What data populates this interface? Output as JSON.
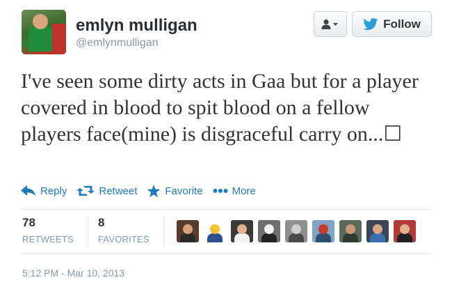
{
  "profile": {
    "display_name": "emlyn mulligan",
    "handle": "@emlynmulligan"
  },
  "buttons": {
    "follow_label": "Follow"
  },
  "tweet": {
    "text": "I've seen some dirty acts in Gaa but for a player covered in blood to spit blood on a fellow players face(mine) is disgraceful carry on...☐"
  },
  "actions": {
    "reply": "Reply",
    "retweet": "Retweet",
    "favorite": "Favorite",
    "more": "More"
  },
  "stats": {
    "retweets_count": "78",
    "retweets_label": "RETWEETS",
    "favorites_count": "8",
    "favorites_label": "FAVORITES"
  },
  "favoriters": [
    {
      "icon": "user-avatar-1",
      "bg": "#5a3a2a",
      "head": "#d6a07c",
      "shirt": "#2a2a2a"
    },
    {
      "icon": "crest-avatar",
      "bg": "#ffffff",
      "head": "#f2c230",
      "shirt": "#2b4f8f"
    },
    {
      "icon": "user-avatar-3",
      "bg": "#3b3b3b",
      "head": "#e2b290",
      "shirt": "#f2f2f2"
    },
    {
      "icon": "user-avatar-4",
      "bg": "#6e6e6e",
      "head": "#eeeeee",
      "shirt": "#222222"
    },
    {
      "icon": "user-avatar-5",
      "bg": "#8f8f8f",
      "head": "#cfcfcf",
      "shirt": "#4a4a4a"
    },
    {
      "icon": "user-avatar-6",
      "bg": "#7fa3c4",
      "head": "#c43b2c",
      "shirt": "#2d4f6e"
    },
    {
      "icon": "user-avatar-7",
      "bg": "#5b6a5a",
      "head": "#c99a7a",
      "shirt": "#2d3a2d"
    },
    {
      "icon": "user-avatar-8",
      "bg": "#3a4656",
      "head": "#d8a886",
      "shirt": "#3b6fb0"
    },
    {
      "icon": "user-avatar-9",
      "bg": "#b23a3a",
      "head": "#e1b08e",
      "shirt": "#202020"
    }
  ],
  "timestamp": "5:12 PM - Mar 10, 2013",
  "colors": {
    "link_blue": "#1f7abd",
    "twitter_bird": "#2a9fd8",
    "muted": "#8899a6"
  }
}
